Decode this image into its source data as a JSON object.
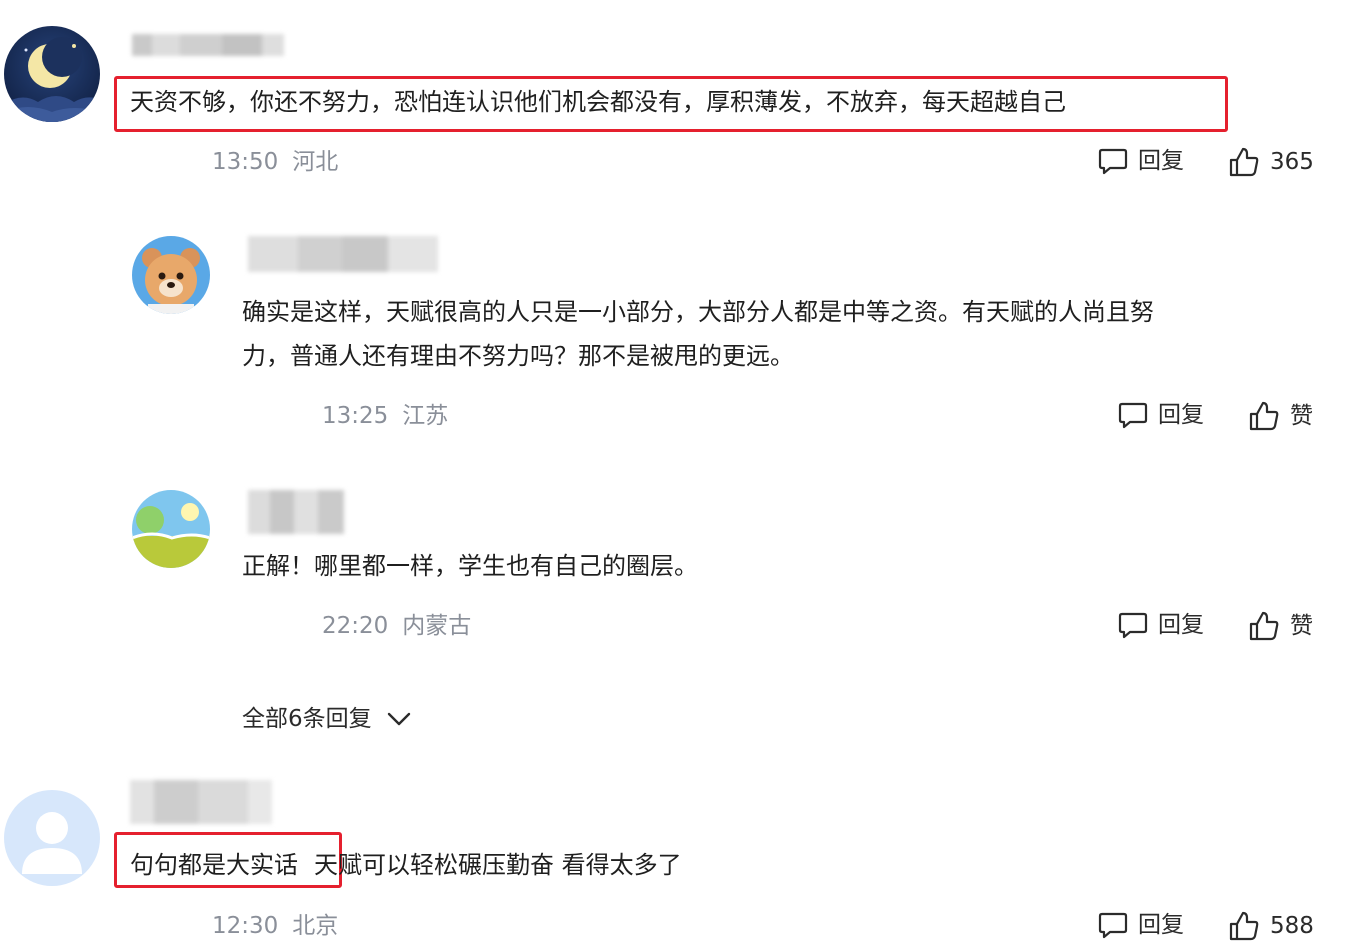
{
  "comments": [
    {
      "text": "天资不够，你还不努力，恐怕连认识他们机会都没有，厚积薄发，不放弃，每天超越自己",
      "time": "13:50",
      "location": "河北",
      "reply_label": "回复",
      "like_label": "365",
      "avatar_icon": "moon-night-avatar"
    },
    {
      "text_line1": "确实是这样，天赋很高的人只是一小部分，大部分人都是中等之资。有天赋的人尚且努",
      "text_line2": "力，普通人还有理由不努力吗？那不是被甩的更远。",
      "time": "13:25",
      "location": "江苏",
      "reply_label": "回复",
      "like_label": "赞",
      "avatar_icon": "bear-avatar"
    },
    {
      "text": "正解！哪里都一样，学生也有自己的圈层。",
      "time": "22:20",
      "location": "内蒙古",
      "reply_label": "回复",
      "like_label": "赞",
      "avatar_icon": "landscape-avatar"
    },
    {
      "text_highlight": "句句都是大实话",
      "text_rest": "天赋可以轻松碾压勤奋 看得太多了",
      "time": "12:30",
      "location": "北京",
      "reply_label": "回复",
      "like_label": "588",
      "avatar_icon": "default-user-avatar"
    }
  ],
  "more_replies_label": "全部6条回复",
  "colors": {
    "highlight_border": "#e5202e",
    "meta_text": "#8a8f99",
    "text": "#1f1f1f"
  }
}
